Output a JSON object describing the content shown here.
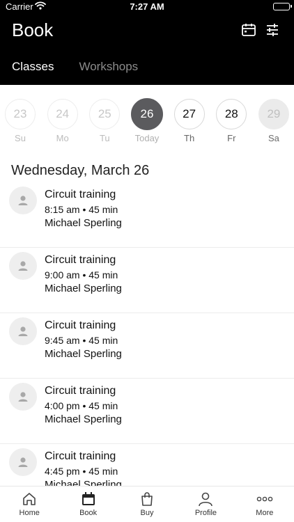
{
  "status": {
    "carrier": "Carrier",
    "time": "7:27 AM"
  },
  "header": {
    "title": "Book",
    "tabs": [
      {
        "label": "Classes",
        "active": true
      },
      {
        "label": "Workshops",
        "active": false
      }
    ]
  },
  "days": [
    {
      "num": "23",
      "label": "Su"
    },
    {
      "num": "24",
      "label": "Mo"
    },
    {
      "num": "25",
      "label": "Tu"
    },
    {
      "num": "26",
      "label": "Today"
    },
    {
      "num": "27",
      "label": "Th"
    },
    {
      "num": "28",
      "label": "Fr"
    },
    {
      "num": "29",
      "label": "Sa"
    }
  ],
  "date_heading": "Wednesday, March 26",
  "classes": [
    {
      "name": "Circuit training",
      "time": "8:15 am • 45 min",
      "teacher": "Michael Sperling"
    },
    {
      "name": "Circuit training",
      "time": "9:00 am • 45 min",
      "teacher": "Michael Sperling"
    },
    {
      "name": "Circuit training",
      "time": "9:45 am • 45 min",
      "teacher": "Michael Sperling"
    },
    {
      "name": "Circuit training",
      "time": "4:00 pm • 45 min",
      "teacher": "Michael Sperling"
    },
    {
      "name": "Circuit training",
      "time": "4:45 pm • 45 min",
      "teacher": "Michael Sperling"
    }
  ],
  "tabbar": [
    {
      "label": "Home",
      "icon": "home-icon"
    },
    {
      "label": "Book",
      "icon": "calendar-icon"
    },
    {
      "label": "Buy",
      "icon": "shopping-bag-icon"
    },
    {
      "label": "Profile",
      "icon": "person-icon"
    },
    {
      "label": "More",
      "icon": "more-dots-icon"
    }
  ],
  "colors": {
    "header_bg": "#000000",
    "today_circle": "#5b5b5e"
  }
}
